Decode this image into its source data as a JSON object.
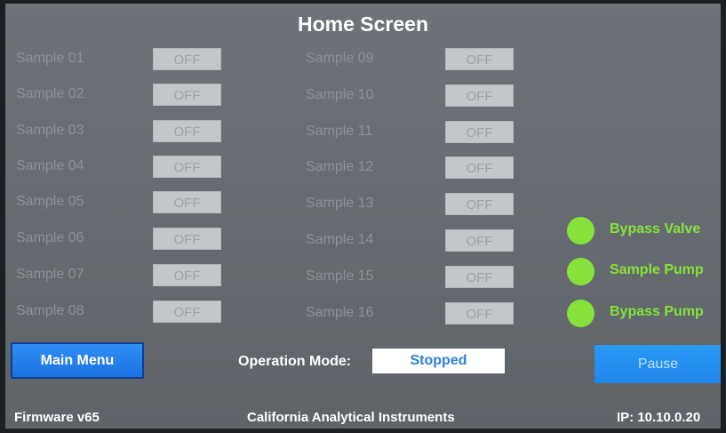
{
  "title": "Home Screen",
  "samples_left": [
    {
      "label": "Sample 01",
      "state": "OFF"
    },
    {
      "label": "Sample 02",
      "state": "OFF"
    },
    {
      "label": "Sample 03",
      "state": "OFF"
    },
    {
      "label": "Sample 04",
      "state": "OFF"
    },
    {
      "label": "Sample 05",
      "state": "OFF"
    },
    {
      "label": "Sample 06",
      "state": "OFF"
    },
    {
      "label": "Sample 07",
      "state": "OFF"
    },
    {
      "label": "Sample 08",
      "state": "OFF"
    }
  ],
  "samples_right": [
    {
      "label": "Sample 09",
      "state": "OFF"
    },
    {
      "label": "Sample 10",
      "state": "OFF"
    },
    {
      "label": "Sample 11",
      "state": "OFF"
    },
    {
      "label": "Sample 12",
      "state": "OFF"
    },
    {
      "label": "Sample 13",
      "state": "OFF"
    },
    {
      "label": "Sample 14",
      "state": "OFF"
    },
    {
      "label": "Sample 15",
      "state": "OFF"
    },
    {
      "label": "Sample 16",
      "state": "OFF"
    }
  ],
  "status": [
    {
      "label": "Bypass Valve",
      "color": "#86e23a"
    },
    {
      "label": "Sample Pump",
      "color": "#86e23a"
    },
    {
      "label": "Bypass Pump",
      "color": "#86e23a"
    }
  ],
  "buttons": {
    "main_menu": "Main Menu",
    "pause": "Pause"
  },
  "operation": {
    "label": "Operation Mode:",
    "value": "Stopped"
  },
  "footer": {
    "firmware": "Firmware v65",
    "company": "California Analytical Instruments",
    "ip": "IP: 10.10.0.20"
  },
  "colors": {
    "accent_blue": "#1f86ea",
    "status_green": "#86e23a"
  }
}
